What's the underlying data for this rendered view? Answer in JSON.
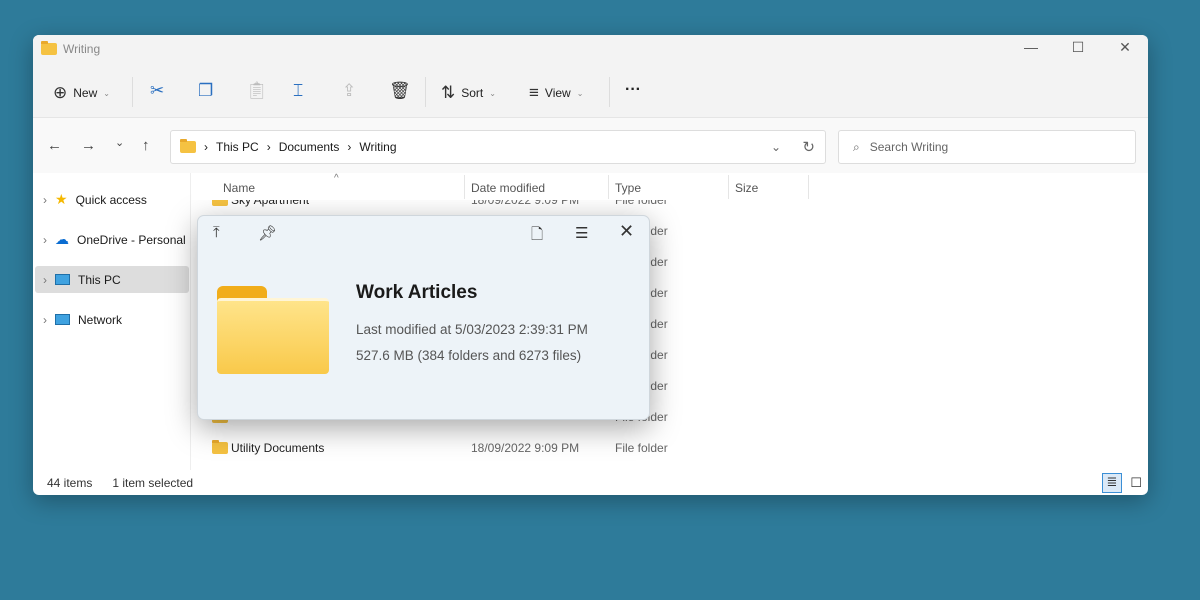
{
  "window": {
    "title": "Writing",
    "minimize": "—",
    "maximize": "☐",
    "close": "✕"
  },
  "toolbar": {
    "new": "New",
    "sort": "Sort",
    "view": "View",
    "more": "···"
  },
  "nav": {
    "back": "←",
    "forward": "→",
    "recent": "⌄",
    "up": "↑",
    "breadcrumb": [
      "This PC",
      "Documents",
      "Writing"
    ],
    "sep": "›",
    "dropdown": "⌄",
    "refresh": "↻",
    "search_placeholder": "Search Writing"
  },
  "sidebar": {
    "items": [
      {
        "label": "Quick access"
      },
      {
        "label": "OneDrive - Personal"
      },
      {
        "label": "This PC"
      },
      {
        "label": "Network"
      }
    ]
  },
  "columns": {
    "name": "Name",
    "date": "Date modified",
    "type": "Type",
    "size": "Size"
  },
  "rows": [
    {
      "name": "Sky Apartment",
      "date": "18/09/2022 9:09 PM",
      "type": "File folder"
    },
    {
      "name": "",
      "date": "",
      "type": "File folder"
    },
    {
      "name": "",
      "date": "",
      "type": "File folder"
    },
    {
      "name": "",
      "date": "",
      "type": "File folder"
    },
    {
      "name": "",
      "date": "",
      "type": "File folder"
    },
    {
      "name": "",
      "date": "",
      "type": "File folder"
    },
    {
      "name": "",
      "date": "",
      "type": "File folder"
    },
    {
      "name": "",
      "date": "",
      "type": "File folder"
    },
    {
      "name": "Utility Documents",
      "date": "18/09/2022 9:09 PM",
      "type": "File folder"
    }
  ],
  "status": {
    "items": "44 items",
    "selected": "1 item selected"
  },
  "popup": {
    "title": "Work Articles",
    "modified": "Last modified at 5/03/2023 2:39:31 PM",
    "size": "527.6 MB (384 folders and 6273 files)"
  },
  "colors": {
    "accent": "#0067c0",
    "folder": "#f5c242",
    "desktop": "#2e7b9a"
  }
}
